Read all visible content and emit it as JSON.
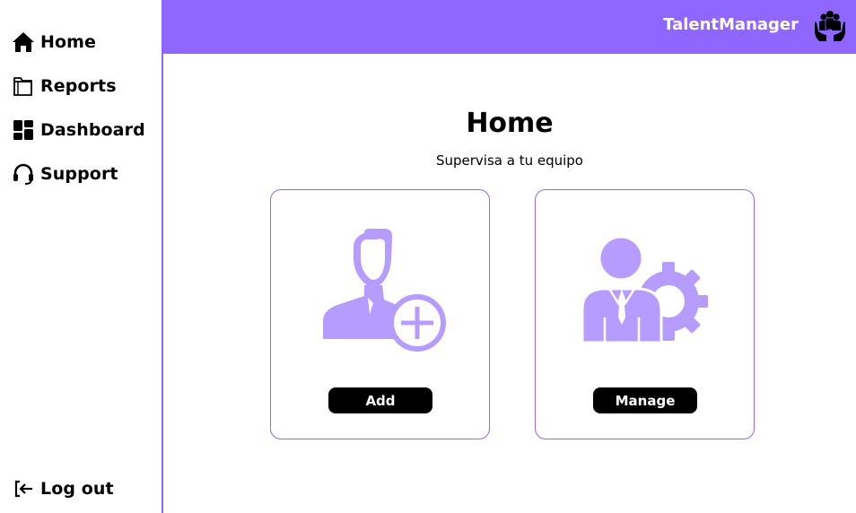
{
  "app": {
    "brand": "TalentManager",
    "accent_color": "#8f66ff",
    "illustration_color": "#b79cff"
  },
  "sidebar": {
    "items": [
      {
        "label": "Home",
        "icon": "home-icon"
      },
      {
        "label": "Reports",
        "icon": "folder-icon"
      },
      {
        "label": "Dashboard",
        "icon": "dashboard-grid-icon"
      },
      {
        "label": "Support",
        "icon": "headset-icon"
      }
    ],
    "logout": {
      "label": "Log out",
      "icon": "logout-icon"
    }
  },
  "main": {
    "title": "Home",
    "subtitle": "Supervisa a tu equipo",
    "cards": [
      {
        "button_label": "Add",
        "icon": "add-user-icon"
      },
      {
        "button_label": "Manage",
        "icon": "manage-user-gear-icon"
      }
    ]
  }
}
